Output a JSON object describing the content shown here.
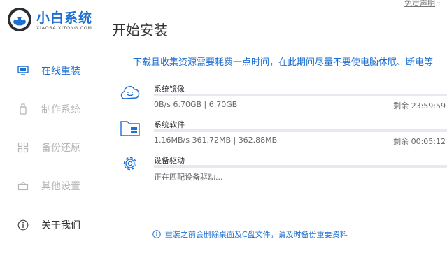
{
  "app": {
    "brand_name": "小白系统",
    "brand_sub": "XIAOBAIXITONG.COM",
    "page_title": "开始安装",
    "disclaimer_link": "免责声明"
  },
  "colors": {
    "accent": "#1d6fd1",
    "inactive": "#b5b5b5",
    "track": "#e6eaf0"
  },
  "sidebar": {
    "items": [
      {
        "label": "在线重装",
        "icon": "monitor-icon",
        "state": "active"
      },
      {
        "label": "制作系统",
        "icon": "usb-drive-icon",
        "state": "disabled"
      },
      {
        "label": "备份还原",
        "icon": "backup-grid-icon",
        "state": "disabled"
      },
      {
        "label": "其他设置",
        "icon": "settings-box-icon",
        "state": "disabled"
      },
      {
        "label": "关于我们",
        "icon": "info-circle-icon",
        "state": "normal"
      }
    ]
  },
  "notice": "下载且收集资源需要耗费一点时间，在此期间尽量不要使电脑休眠、断电等",
  "tasks": [
    {
      "name": "系统镜像",
      "icon": "cloud-face-icon",
      "detail": "0B/s 6.70GB | 6.70GB",
      "remaining": "剩余 23:59:59",
      "progress": 0
    },
    {
      "name": "系统软件",
      "icon": "folder-apps-icon",
      "detail": "1.16MB/s 361.72MB | 362.88MB",
      "remaining": "剩余 00:05:12",
      "progress": 0
    },
    {
      "name": "设备驱动",
      "icon": "gear-icon",
      "detail": "正在匹配设备驱动...",
      "remaining": "",
      "progress": 0
    }
  ],
  "warning": "重装之前会删除桌面及C盘文件，请及时备份重要资料"
}
